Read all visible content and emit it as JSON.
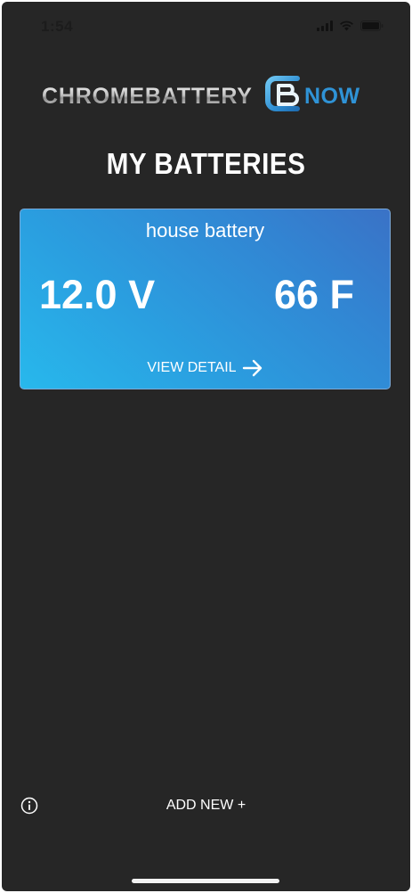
{
  "status_bar": {
    "time": "1:54",
    "icons": [
      "cellular-signal-icon",
      "wifi-icon",
      "battery-icon"
    ]
  },
  "brand": {
    "left_text": "CHROMEBATTERY",
    "right_text": "NOW",
    "colors": {
      "accent": "#2f93d6",
      "chrome": "#c9c9c9"
    }
  },
  "header": {
    "title": "MY BATTERIES"
  },
  "batteries": [
    {
      "name": "house battery",
      "voltage": "12.0 V",
      "temperature": "66 F",
      "detail_label": "VIEW DETAIL",
      "detail_icon": "arrow-right-icon"
    }
  ],
  "footer": {
    "info_icon": "info-icon",
    "add_new_label": "ADD NEW +"
  },
  "colors": {
    "background": "#262626",
    "card_gradient_start": "#28b8ec",
    "card_gradient_end": "#3a72c6",
    "text": "#ffffff"
  }
}
